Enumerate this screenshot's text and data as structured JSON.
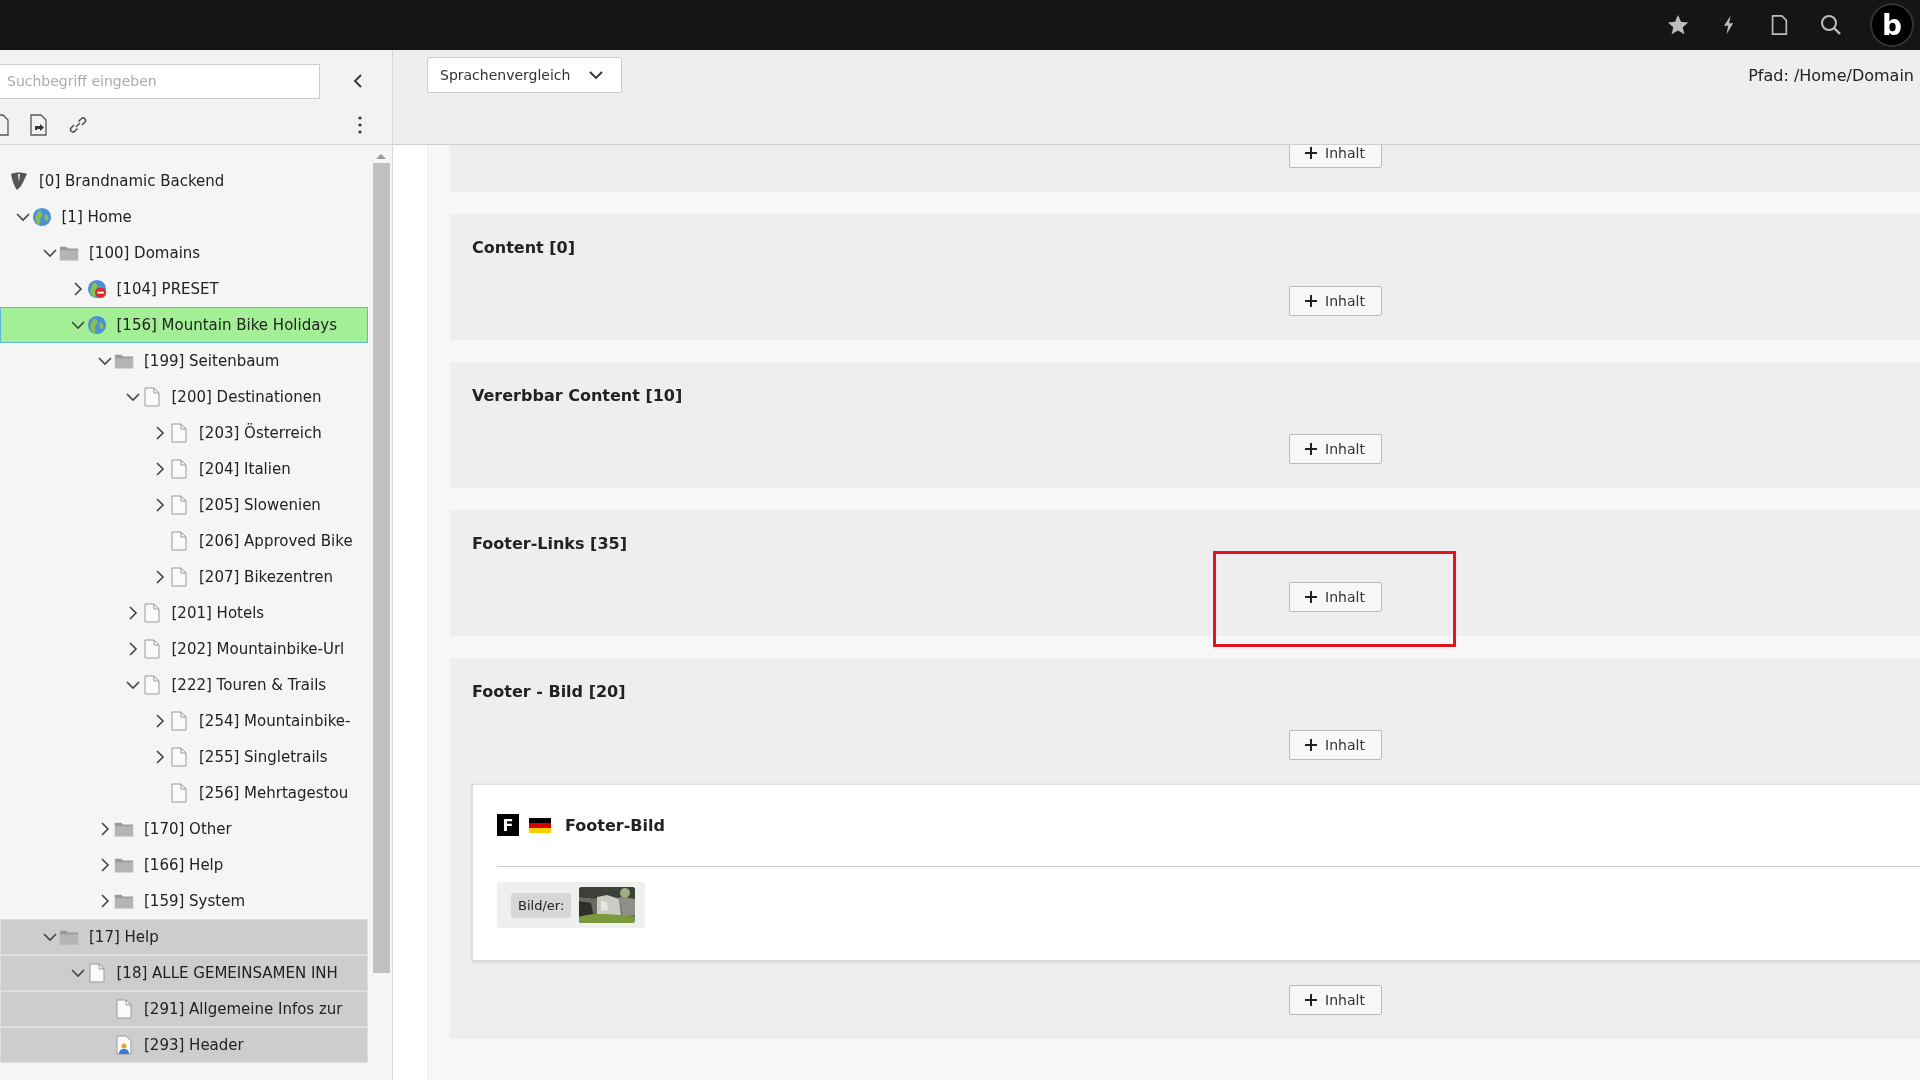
{
  "topbar": {
    "avatar_letter": "b"
  },
  "page_tree": {
    "search": {
      "placeholder": "Suchbegriff eingeben"
    },
    "nodes": [
      {
        "label": "[0] Brandnamic Backend",
        "kind": "root",
        "selected": false,
        "shaded": false,
        "children": [
          {
            "label": "[1] Home",
            "kind": "globe",
            "expanded": true,
            "selected": false,
            "shaded": false,
            "children": [
              {
                "label": "[100] Domains",
                "kind": "folder",
                "expanded": true,
                "selected": false,
                "shaded": false,
                "children": [
                  {
                    "label": "[104] PRESET",
                    "kind": "globe-disabled",
                    "expanded": false,
                    "selected": false,
                    "shaded": false
                  },
                  {
                    "label": "[156] Mountain Bike Holidays",
                    "kind": "globe",
                    "expanded": true,
                    "selected": true,
                    "shaded": false,
                    "children": [
                      {
                        "label": "[199] Seitenbaum",
                        "kind": "folder",
                        "expanded": true,
                        "selected": false,
                        "shaded": false,
                        "children": [
                          {
                            "label": "[200] Destinationen",
                            "kind": "page",
                            "expanded": true,
                            "selected": false,
                            "shaded": false,
                            "children": [
                              {
                                "label": "[203] Österreich",
                                "kind": "page",
                                "expanded": false,
                                "selected": false,
                                "shaded": false
                              },
                              {
                                "label": "[204] Italien",
                                "kind": "page",
                                "expanded": false,
                                "selected": false,
                                "shaded": false
                              },
                              {
                                "label": "[205] Slowenien",
                                "kind": "page",
                                "expanded": false,
                                "selected": false,
                                "shaded": false
                              },
                              {
                                "label": "[206] Approved Bike",
                                "kind": "page",
                                "selected": false,
                                "shaded": false
                              },
                              {
                                "label": "[207] Bikezentren",
                                "kind": "page",
                                "expanded": false,
                                "selected": false,
                                "shaded": false
                              }
                            ]
                          },
                          {
                            "label": "[201] Hotels",
                            "kind": "page",
                            "expanded": false,
                            "selected": false,
                            "shaded": false
                          },
                          {
                            "label": "[202] Mountainbike-Url",
                            "kind": "page",
                            "expanded": false,
                            "selected": false,
                            "shaded": false
                          },
                          {
                            "label": "[222] Touren & Trails",
                            "kind": "page",
                            "expanded": true,
                            "selected": false,
                            "shaded": false,
                            "children": [
                              {
                                "label": "[254] Mountainbike-",
                                "kind": "page",
                                "expanded": false,
                                "selected": false,
                                "shaded": false
                              },
                              {
                                "label": "[255] Singletrails",
                                "kind": "page",
                                "expanded": false,
                                "selected": false,
                                "shaded": false
                              },
                              {
                                "label": "[256] Mehrtagestou",
                                "kind": "page",
                                "selected": false,
                                "shaded": false
                              }
                            ]
                          }
                        ]
                      },
                      {
                        "label": "[170] Other",
                        "kind": "folder",
                        "expanded": false,
                        "selected": false,
                        "shaded": false
                      },
                      {
                        "label": "[166] Help",
                        "kind": "folder",
                        "expanded": false,
                        "selected": false,
                        "shaded": false
                      },
                      {
                        "label": "[159] System",
                        "kind": "folder",
                        "expanded": false,
                        "selected": false,
                        "shaded": false
                      }
                    ]
                  }
                ]
              },
              {
                "label": "[17] Help",
                "kind": "folder",
                "expanded": true,
                "selected": false,
                "shaded": true,
                "children": [
                  {
                    "label": "[18] ALLE GEMEINSAMEN INH",
                    "kind": "page",
                    "expanded": true,
                    "selected": false,
                    "shaded": true,
                    "children": [
                      {
                        "label": "[291] Allgemeine Infos zur",
                        "kind": "page",
                        "selected": false,
                        "shaded": true
                      },
                      {
                        "label": "[293] Header",
                        "kind": "page-user",
                        "selected": false,
                        "shaded": true
                      }
                    ]
                  }
                ]
              }
            ]
          }
        ]
      }
    ]
  },
  "module_header": {
    "view_select": {
      "value": "Sprachenvergleich"
    },
    "path": "Pfad: /Home/Domain"
  },
  "content_areas": [
    {
      "items": [
        {
          "kind": "add",
          "label": "Inhalt",
          "highlighted": false
        }
      ]
    },
    {
      "title": "Content [0]",
      "items": [
        {
          "kind": "add",
          "label": "Inhalt",
          "highlighted": false
        }
      ]
    },
    {
      "title": "Vererbbar Content [10]",
      "items": [
        {
          "kind": "add",
          "label": "Inhalt",
          "highlighted": false
        }
      ]
    },
    {
      "title": "Footer-Links [35]",
      "items": [
        {
          "kind": "add",
          "label": "Inhalt",
          "highlighted": true
        }
      ]
    },
    {
      "title": "Footer - Bild [20]",
      "items": [
        {
          "kind": "add",
          "label": "Inhalt",
          "highlighted": false
        },
        {
          "kind": "element",
          "type_badge": "F",
          "title": "Footer-Bild",
          "field_label": "Bild/er:"
        },
        {
          "kind": "add",
          "label": "Inhalt",
          "highlighted": false
        }
      ]
    }
  ]
}
